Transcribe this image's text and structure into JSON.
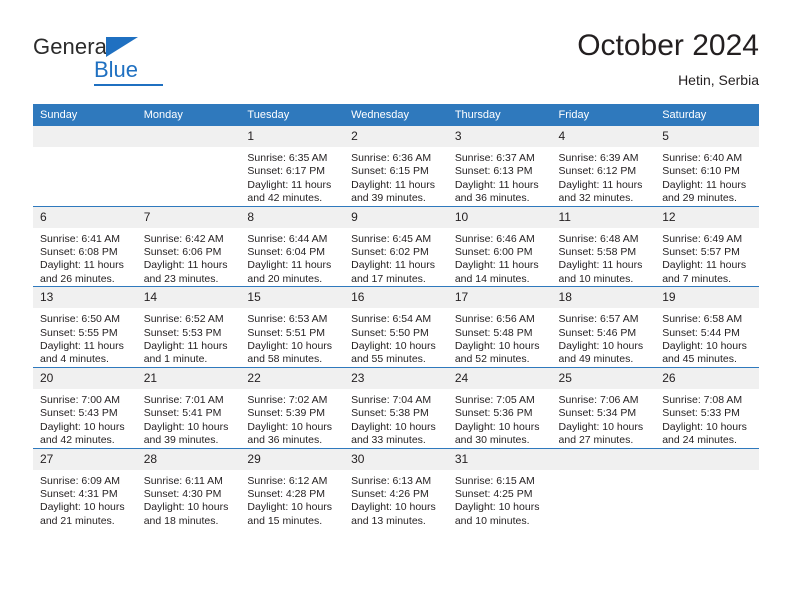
{
  "brand": {
    "line1": "General",
    "line2": "Blue",
    "triangle_icon": "blue-triangle-icon",
    "colors": {
      "text": "#2b2b2b",
      "accent": "#1f70c1"
    }
  },
  "header": {
    "month_title": "October 2024",
    "location": "Hetin, Serbia"
  },
  "colors": {
    "header_bar": "#2f79bd",
    "daynum_band": "#f0f0f0",
    "row_rule": "#2f79bd",
    "text": "#231f20"
  },
  "calendar": {
    "weekday_headers": [
      "Sunday",
      "Monday",
      "Tuesday",
      "Wednesday",
      "Thursday",
      "Friday",
      "Saturday"
    ],
    "labels": {
      "sunrise": "Sunrise:",
      "sunset": "Sunset:",
      "daylight": "Daylight:"
    },
    "weeks": [
      [
        {
          "day": "",
          "empty": true
        },
        {
          "day": "",
          "empty": true
        },
        {
          "day": "1",
          "sunrise": "Sunrise: 6:35 AM",
          "sunset": "Sunset: 6:17 PM",
          "daylight_line1": "Daylight: 11 hours",
          "daylight_line2": "and 42 minutes."
        },
        {
          "day": "2",
          "sunrise": "Sunrise: 6:36 AM",
          "sunset": "Sunset: 6:15 PM",
          "daylight_line1": "Daylight: 11 hours",
          "daylight_line2": "and 39 minutes."
        },
        {
          "day": "3",
          "sunrise": "Sunrise: 6:37 AM",
          "sunset": "Sunset: 6:13 PM",
          "daylight_line1": "Daylight: 11 hours",
          "daylight_line2": "and 36 minutes."
        },
        {
          "day": "4",
          "sunrise": "Sunrise: 6:39 AM",
          "sunset": "Sunset: 6:12 PM",
          "daylight_line1": "Daylight: 11 hours",
          "daylight_line2": "and 32 minutes."
        },
        {
          "day": "5",
          "sunrise": "Sunrise: 6:40 AM",
          "sunset": "Sunset: 6:10 PM",
          "daylight_line1": "Daylight: 11 hours",
          "daylight_line2": "and 29 minutes."
        }
      ],
      [
        {
          "day": "6",
          "sunrise": "Sunrise: 6:41 AM",
          "sunset": "Sunset: 6:08 PM",
          "daylight_line1": "Daylight: 11 hours",
          "daylight_line2": "and 26 minutes."
        },
        {
          "day": "7",
          "sunrise": "Sunrise: 6:42 AM",
          "sunset": "Sunset: 6:06 PM",
          "daylight_line1": "Daylight: 11 hours",
          "daylight_line2": "and 23 minutes."
        },
        {
          "day": "8",
          "sunrise": "Sunrise: 6:44 AM",
          "sunset": "Sunset: 6:04 PM",
          "daylight_line1": "Daylight: 11 hours",
          "daylight_line2": "and 20 minutes."
        },
        {
          "day": "9",
          "sunrise": "Sunrise: 6:45 AM",
          "sunset": "Sunset: 6:02 PM",
          "daylight_line1": "Daylight: 11 hours",
          "daylight_line2": "and 17 minutes."
        },
        {
          "day": "10",
          "sunrise": "Sunrise: 6:46 AM",
          "sunset": "Sunset: 6:00 PM",
          "daylight_line1": "Daylight: 11 hours",
          "daylight_line2": "and 14 minutes."
        },
        {
          "day": "11",
          "sunrise": "Sunrise: 6:48 AM",
          "sunset": "Sunset: 5:58 PM",
          "daylight_line1": "Daylight: 11 hours",
          "daylight_line2": "and 10 minutes."
        },
        {
          "day": "12",
          "sunrise": "Sunrise: 6:49 AM",
          "sunset": "Sunset: 5:57 PM",
          "daylight_line1": "Daylight: 11 hours",
          "daylight_line2": "and 7 minutes."
        }
      ],
      [
        {
          "day": "13",
          "sunrise": "Sunrise: 6:50 AM",
          "sunset": "Sunset: 5:55 PM",
          "daylight_line1": "Daylight: 11 hours",
          "daylight_line2": "and 4 minutes."
        },
        {
          "day": "14",
          "sunrise": "Sunrise: 6:52 AM",
          "sunset": "Sunset: 5:53 PM",
          "daylight_line1": "Daylight: 11 hours",
          "daylight_line2": "and 1 minute."
        },
        {
          "day": "15",
          "sunrise": "Sunrise: 6:53 AM",
          "sunset": "Sunset: 5:51 PM",
          "daylight_line1": "Daylight: 10 hours",
          "daylight_line2": "and 58 minutes."
        },
        {
          "day": "16",
          "sunrise": "Sunrise: 6:54 AM",
          "sunset": "Sunset: 5:50 PM",
          "daylight_line1": "Daylight: 10 hours",
          "daylight_line2": "and 55 minutes."
        },
        {
          "day": "17",
          "sunrise": "Sunrise: 6:56 AM",
          "sunset": "Sunset: 5:48 PM",
          "daylight_line1": "Daylight: 10 hours",
          "daylight_line2": "and 52 minutes."
        },
        {
          "day": "18",
          "sunrise": "Sunrise: 6:57 AM",
          "sunset": "Sunset: 5:46 PM",
          "daylight_line1": "Daylight: 10 hours",
          "daylight_line2": "and 49 minutes."
        },
        {
          "day": "19",
          "sunrise": "Sunrise: 6:58 AM",
          "sunset": "Sunset: 5:44 PM",
          "daylight_line1": "Daylight: 10 hours",
          "daylight_line2": "and 45 minutes."
        }
      ],
      [
        {
          "day": "20",
          "sunrise": "Sunrise: 7:00 AM",
          "sunset": "Sunset: 5:43 PM",
          "daylight_line1": "Daylight: 10 hours",
          "daylight_line2": "and 42 minutes."
        },
        {
          "day": "21",
          "sunrise": "Sunrise: 7:01 AM",
          "sunset": "Sunset: 5:41 PM",
          "daylight_line1": "Daylight: 10 hours",
          "daylight_line2": "and 39 minutes."
        },
        {
          "day": "22",
          "sunrise": "Sunrise: 7:02 AM",
          "sunset": "Sunset: 5:39 PM",
          "daylight_line1": "Daylight: 10 hours",
          "daylight_line2": "and 36 minutes."
        },
        {
          "day": "23",
          "sunrise": "Sunrise: 7:04 AM",
          "sunset": "Sunset: 5:38 PM",
          "daylight_line1": "Daylight: 10 hours",
          "daylight_line2": "and 33 minutes."
        },
        {
          "day": "24",
          "sunrise": "Sunrise: 7:05 AM",
          "sunset": "Sunset: 5:36 PM",
          "daylight_line1": "Daylight: 10 hours",
          "daylight_line2": "and 30 minutes."
        },
        {
          "day": "25",
          "sunrise": "Sunrise: 7:06 AM",
          "sunset": "Sunset: 5:34 PM",
          "daylight_line1": "Daylight: 10 hours",
          "daylight_line2": "and 27 minutes."
        },
        {
          "day": "26",
          "sunrise": "Sunrise: 7:08 AM",
          "sunset": "Sunset: 5:33 PM",
          "daylight_line1": "Daylight: 10 hours",
          "daylight_line2": "and 24 minutes."
        }
      ],
      [
        {
          "day": "27",
          "sunrise": "Sunrise: 6:09 AM",
          "sunset": "Sunset: 4:31 PM",
          "daylight_line1": "Daylight: 10 hours",
          "daylight_line2": "and 21 minutes."
        },
        {
          "day": "28",
          "sunrise": "Sunrise: 6:11 AM",
          "sunset": "Sunset: 4:30 PM",
          "daylight_line1": "Daylight: 10 hours",
          "daylight_line2": "and 18 minutes."
        },
        {
          "day": "29",
          "sunrise": "Sunrise: 6:12 AM",
          "sunset": "Sunset: 4:28 PM",
          "daylight_line1": "Daylight: 10 hours",
          "daylight_line2": "and 15 minutes."
        },
        {
          "day": "30",
          "sunrise": "Sunrise: 6:13 AM",
          "sunset": "Sunset: 4:26 PM",
          "daylight_line1": "Daylight: 10 hours",
          "daylight_line2": "and 13 minutes."
        },
        {
          "day": "31",
          "sunrise": "Sunrise: 6:15 AM",
          "sunset": "Sunset: 4:25 PM",
          "daylight_line1": "Daylight: 10 hours",
          "daylight_line2": "and 10 minutes."
        },
        {
          "day": "",
          "empty": true
        },
        {
          "day": "",
          "empty": true
        }
      ]
    ]
  }
}
